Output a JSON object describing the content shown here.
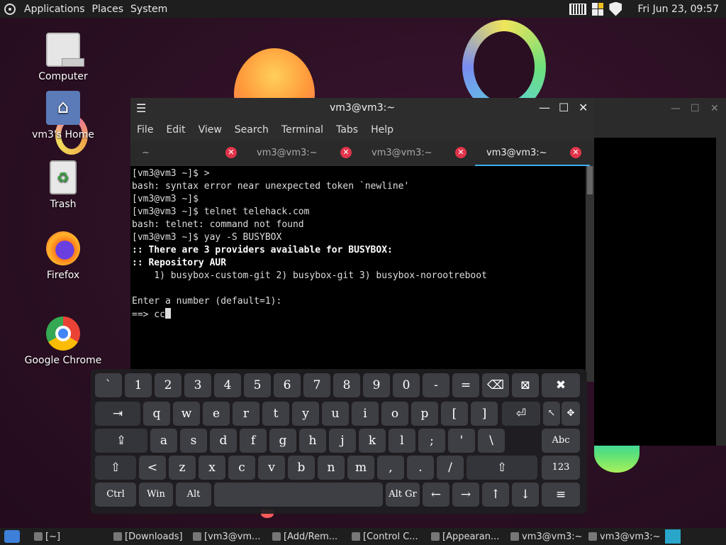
{
  "top_panel": {
    "menu": [
      "Applications",
      "Places",
      "System"
    ],
    "clock": "Fri Jun 23, 09:57",
    "icons": [
      "distro-logo-icon",
      "keyboard-icon",
      "flag-icon",
      "shield-icon"
    ]
  },
  "desktop_icons": [
    {
      "label": "Computer",
      "icon": "computer-icon"
    },
    {
      "label": "vm3's Home",
      "icon": "home-folder-icon"
    },
    {
      "label": "Trash",
      "icon": "trash-icon"
    },
    {
      "label": "Firefox",
      "icon": "firefox-icon"
    },
    {
      "label": "Google Chrome",
      "icon": "chrome-icon"
    }
  ],
  "terminal": {
    "title": "vm3@vm3:~",
    "menu": [
      "File",
      "Edit",
      "View",
      "Search",
      "Terminal",
      "Tabs",
      "Help"
    ],
    "tabs": [
      {
        "label": "~",
        "active": false
      },
      {
        "label": "vm3@vm3:~",
        "active": false
      },
      {
        "label": "vm3@vm3:~",
        "active": false
      },
      {
        "label": "vm3@vm3:~",
        "active": true
      }
    ],
    "lines": [
      {
        "text": "[vm3@vm3 ~]$ >",
        "bold": false
      },
      {
        "text": "bash: syntax error near unexpected token `newline'",
        "bold": false
      },
      {
        "text": "[vm3@vm3 ~]$",
        "bold": false
      },
      {
        "text": "[vm3@vm3 ~]$ telnet telehack.com",
        "bold": false
      },
      {
        "text": "bash: telnet: command not found",
        "bold": false
      },
      {
        "text": "[vm3@vm3 ~]$ yay -S BUSYBOX",
        "bold": false
      },
      {
        "text": ":: There are 3 providers available for BUSYBOX:",
        "bold": true
      },
      {
        "text": ":: Repository AUR",
        "bold": true
      },
      {
        "text": "    1) busybox-custom-git 2) busybox-git 3) busybox-norootreboot",
        "bold": false
      },
      {
        "text": "",
        "bold": false
      },
      {
        "text": "Enter a number (default=1):",
        "bold": false
      }
    ],
    "prompt_line": "==> cc"
  },
  "keyboard": {
    "row1": [
      "`",
      "1",
      "2",
      "3",
      "4",
      "5",
      "6",
      "7",
      "8",
      "9",
      "0",
      "-",
      "="
    ],
    "row2": [
      "q",
      "w",
      "e",
      "r",
      "t",
      "y",
      "u",
      "i",
      "o",
      "p",
      "[",
      "]"
    ],
    "row3": [
      "a",
      "s",
      "d",
      "f",
      "g",
      "h",
      "j",
      "k",
      "l",
      ";",
      "'",
      "\\"
    ],
    "row4": [
      "<",
      "z",
      "x",
      "c",
      "v",
      "b",
      "n",
      "m",
      ",",
      ".",
      "/"
    ],
    "tab_key": "⇥",
    "caps_key": "⇪",
    "shift_key": "⇧",
    "backspace_key": "⌫",
    "clear_key": "⊠",
    "close_key": "✖",
    "enter_key": "⏎",
    "pointer_key": "↖",
    "move_key": "✥",
    "abc_key": "Abc",
    "num_key": "123",
    "ctrl_key": "Ctrl",
    "win_key": "Win",
    "alt_key": "Alt",
    "altgr_key": "Alt Gr",
    "arrows": [
      "←",
      "→",
      "↑",
      "↓"
    ],
    "menu_key": "≡"
  },
  "taskbar": {
    "items": [
      {
        "label": "[~]"
      },
      {
        "label": "[Downloads]"
      },
      {
        "label": "[vm3@vm..."
      },
      {
        "label": "[Add/Rem..."
      },
      {
        "label": "[Control C..."
      },
      {
        "label": "[Appearan..."
      },
      {
        "label": "vm3@vm3:~"
      },
      {
        "label": "vm3@vm3:~"
      }
    ]
  }
}
